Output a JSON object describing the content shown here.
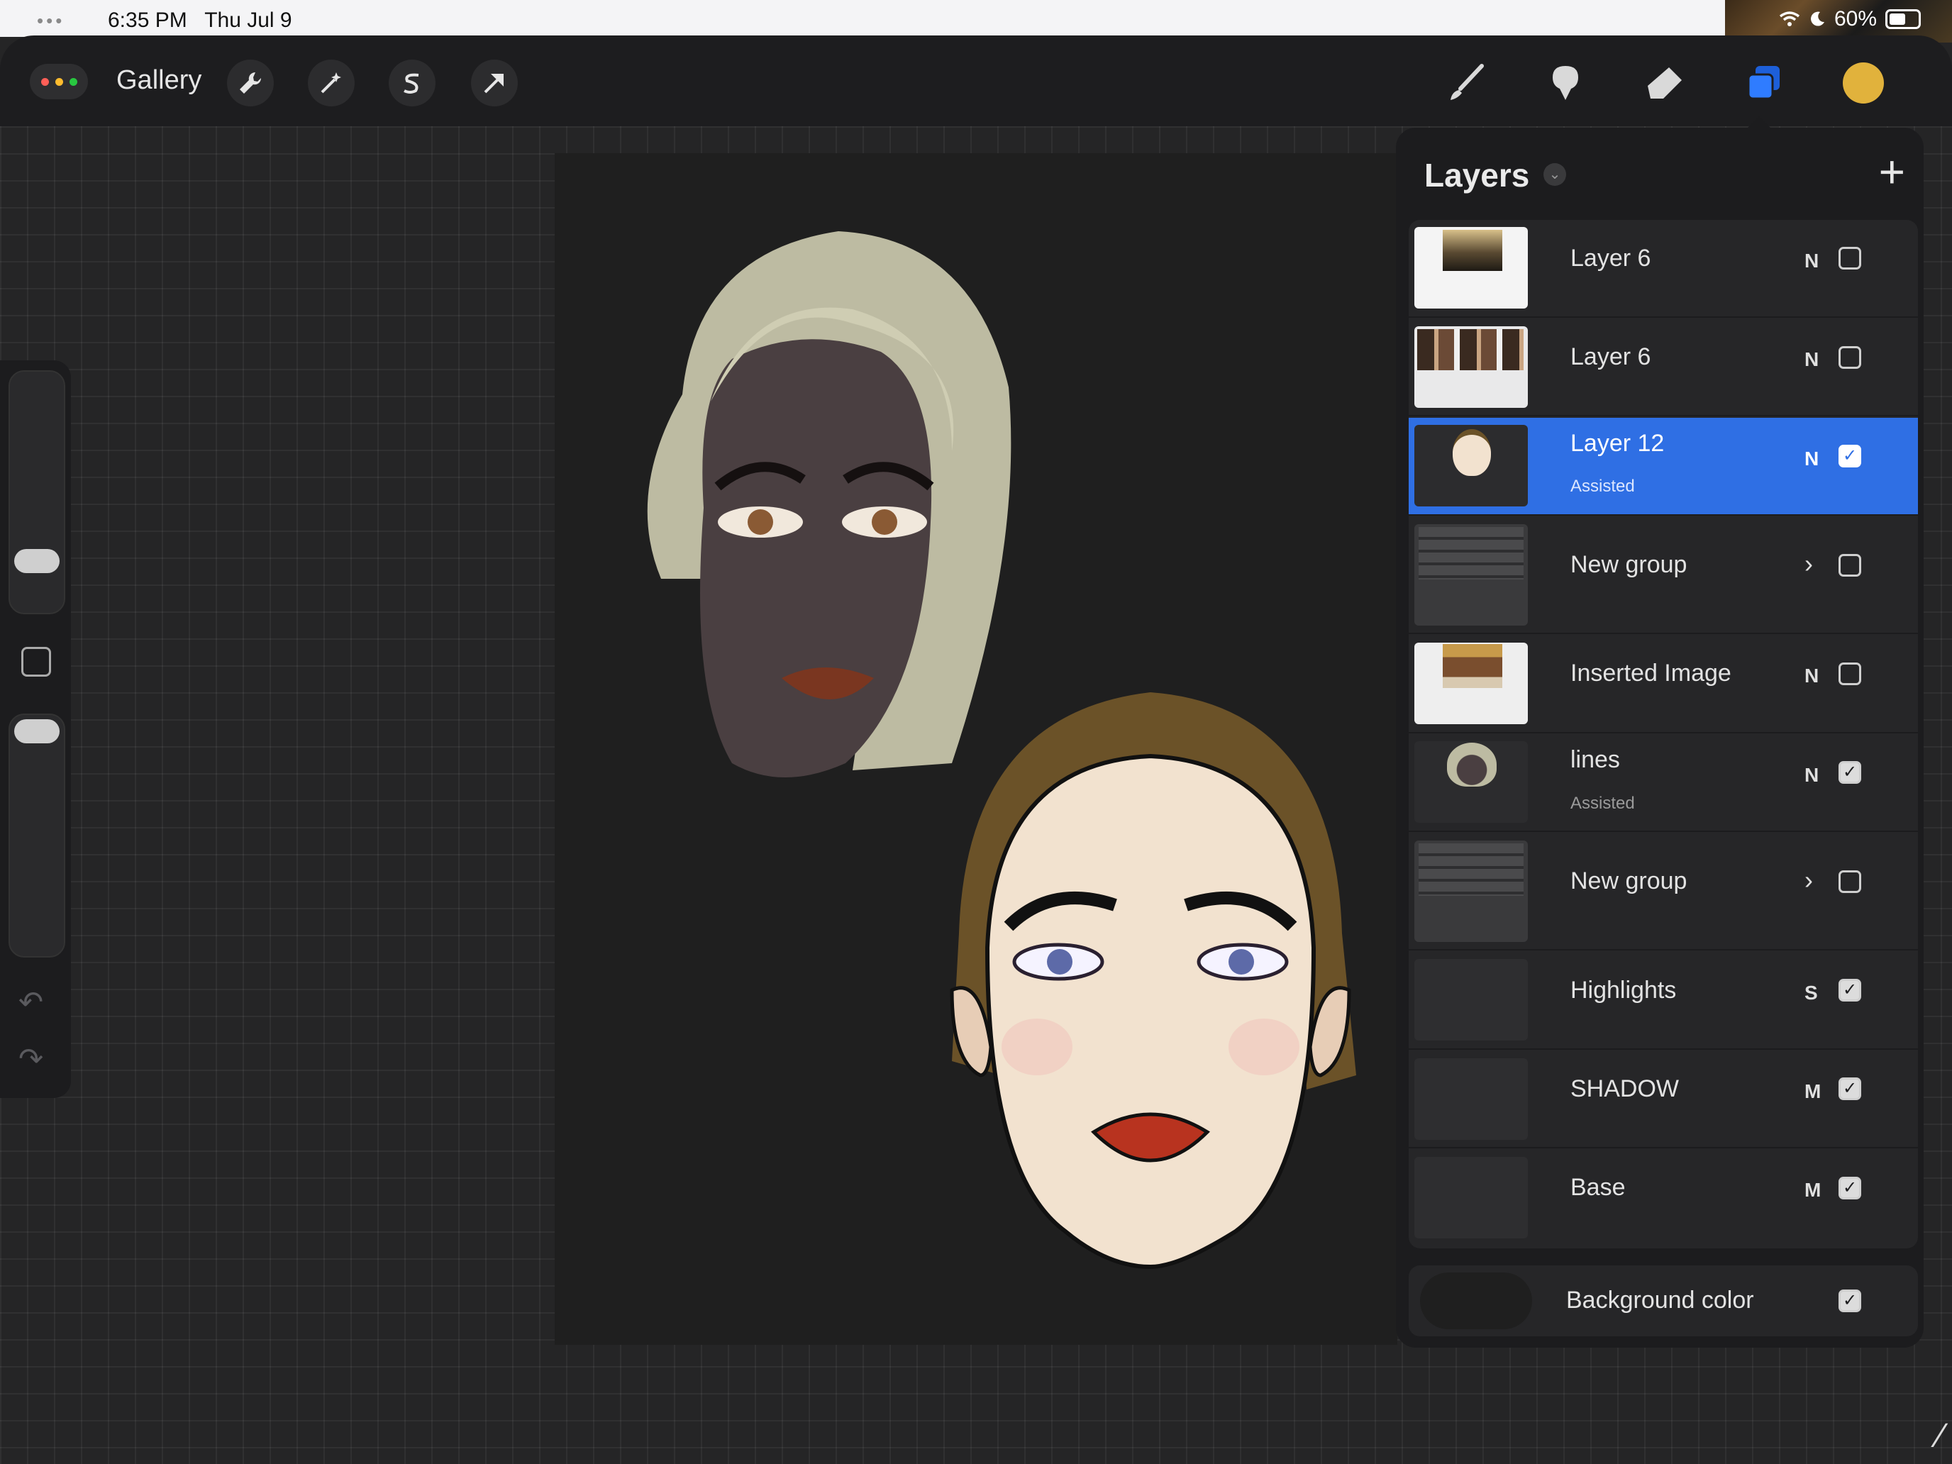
{
  "status_bar": {
    "time": "6:35 PM",
    "date": "Thu Jul 9",
    "battery": "60%",
    "icons": [
      "wifi-icon",
      "moon-icon",
      "battery-icon"
    ]
  },
  "toolbar": {
    "gallery_label": "Gallery",
    "left_tools": [
      "wrench-icon",
      "magic-wand-icon",
      "selection-s-icon",
      "transform-arrow-icon"
    ],
    "right_tools": [
      "brush-icon",
      "smudge-icon",
      "eraser-icon",
      "layers-icon"
    ],
    "active_color": "#e1b23c"
  },
  "layers_panel": {
    "title": "Layers",
    "add_icon": "plus-icon",
    "layers": [
      {
        "name": "Layer 6",
        "sub": "",
        "mode": "N",
        "checked": false,
        "selected": false,
        "group": false
      },
      {
        "name": "Layer 6",
        "sub": "",
        "mode": "N",
        "checked": false,
        "selected": false,
        "group": false
      },
      {
        "name": "Layer 12",
        "sub": "Assisted",
        "mode": "N",
        "checked": true,
        "selected": true,
        "group": false
      },
      {
        "name": "New group",
        "sub": "",
        "mode": "",
        "checked": false,
        "selected": false,
        "group": true
      },
      {
        "name": "Inserted Image",
        "sub": "",
        "mode": "N",
        "checked": false,
        "selected": false,
        "group": false
      },
      {
        "name": "lines",
        "sub": "Assisted",
        "mode": "N",
        "checked": true,
        "selected": false,
        "group": false
      },
      {
        "name": "New group",
        "sub": "",
        "mode": "",
        "checked": false,
        "selected": false,
        "group": true
      },
      {
        "name": "Highlights",
        "sub": "",
        "mode": "S",
        "checked": true,
        "selected": false,
        "group": false
      },
      {
        "name": "SHADOW",
        "sub": "",
        "mode": "M",
        "checked": true,
        "selected": false,
        "group": false
      },
      {
        "name": "Base",
        "sub": "",
        "mode": "M",
        "checked": true,
        "selected": false,
        "group": false
      }
    ],
    "background_label": "Background color",
    "background_checked": true
  },
  "colors": {
    "selected_row": "#2f6fe4",
    "hair_blonde": "#bdbba2",
    "hair_brown": "#6b5228"
  }
}
